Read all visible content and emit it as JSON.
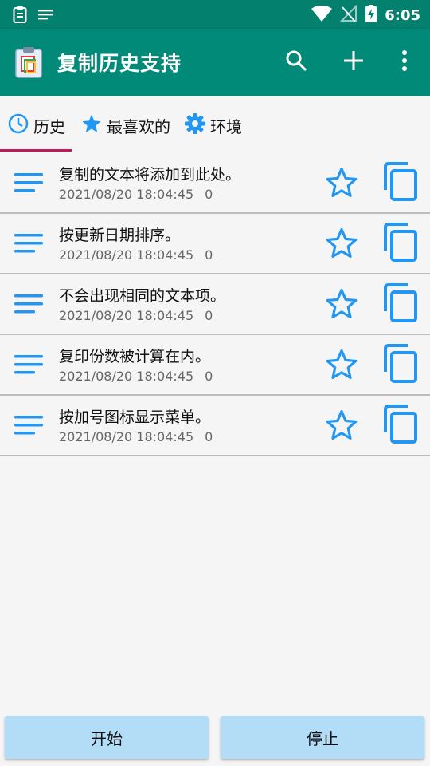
{
  "status_bar": {
    "time": "6:05"
  },
  "app_bar": {
    "title": "复制历史支持"
  },
  "tabs": [
    {
      "label": "历史",
      "icon": "clock-icon"
    },
    {
      "label": "最喜欢的",
      "icon": "star-icon"
    },
    {
      "label": "环境",
      "icon": "gear-icon"
    }
  ],
  "items": [
    {
      "title": "复制的文本将添加到此处。",
      "timestamp": "2021/08/20 18:04:45",
      "count": "0"
    },
    {
      "title": "按更新日期排序。",
      "timestamp": "2021/08/20 18:04:45",
      "count": "0"
    },
    {
      "title": "不会出现相同的文本项。",
      "timestamp": "2021/08/20 18:04:45",
      "count": "0"
    },
    {
      "title": "复印份数被计算在内。",
      "timestamp": "2021/08/20 18:04:45",
      "count": "0"
    },
    {
      "title": "按加号图标显示菜单。",
      "timestamp": "2021/08/20 18:04:45",
      "count": "0"
    }
  ],
  "buttons": {
    "start": "开始",
    "stop": "停止"
  },
  "colors": {
    "app_bar": "#028a78",
    "status_bar": "#04806f",
    "accent": "#2196f3",
    "tab_indicator": "#c2185b",
    "button_bg": "#b3dcf7"
  }
}
